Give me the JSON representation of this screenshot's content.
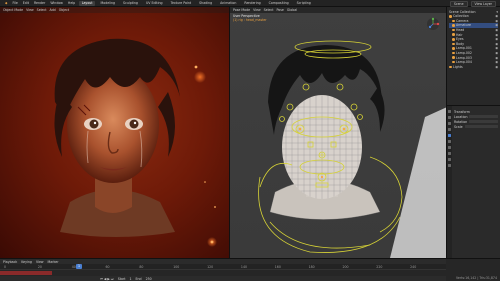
{
  "topbar": {
    "menu": [
      "File",
      "Edit",
      "Render",
      "Window",
      "Help"
    ],
    "workspaces": [
      "Layout",
      "Modeling",
      "Sculpting",
      "UV Editing",
      "Texture Paint",
      "Shading",
      "Animation",
      "Rendering",
      "Compositing",
      "Scripting"
    ],
    "active_workspace": "Layout",
    "scene_label": "Scene",
    "view_layer_label": "View Layer"
  },
  "left_viewport": {
    "header_items": [
      "Object Mode",
      "View",
      "Select",
      "Add",
      "Object"
    ]
  },
  "right_viewport": {
    "header_items": [
      "Pose Mode",
      "View",
      "Select",
      "Pose",
      "Global"
    ],
    "overlay_line1": "User Perspective",
    "overlay_line2": "(1) rig : head_master"
  },
  "outliner": {
    "title": "Scene Collection",
    "items": [
      {
        "label": "Collection",
        "indent": 0
      },
      {
        "label": "Camera",
        "indent": 1
      },
      {
        "label": "Armature",
        "indent": 1
      },
      {
        "label": "Head",
        "indent": 1
      },
      {
        "label": "Hair",
        "indent": 1
      },
      {
        "label": "Eyes",
        "indent": 1
      },
      {
        "label": "Body",
        "indent": 1
      },
      {
        "label": "Lamp.001",
        "indent": 1
      },
      {
        "label": "Lamp.002",
        "indent": 1
      },
      {
        "label": "Lamp.003",
        "indent": 1
      },
      {
        "label": "Lamp.004",
        "indent": 1
      },
      {
        "label": "Lights",
        "indent": 0
      }
    ],
    "selected_index": 2
  },
  "properties": {
    "rows": [
      "Transform",
      "Location",
      "Rotation",
      "Scale"
    ]
  },
  "timeline": {
    "header_items": [
      "Playback",
      "Keying",
      "View",
      "Marker"
    ],
    "current_frame": "1",
    "ticks": [
      "0",
      "20",
      "40",
      "60",
      "80",
      "100",
      "120",
      "140",
      "160",
      "180",
      "200",
      "220",
      "240"
    ],
    "start_label": "Start",
    "start_value": "1",
    "end_label": "End",
    "end_value": "250"
  },
  "status": {
    "text": "Verts:16,142 | Tris:31,874"
  },
  "colors": {
    "accent": "#4a7fd1",
    "rig_yellow": "#d6d236",
    "background_red": "#8b2a10"
  }
}
